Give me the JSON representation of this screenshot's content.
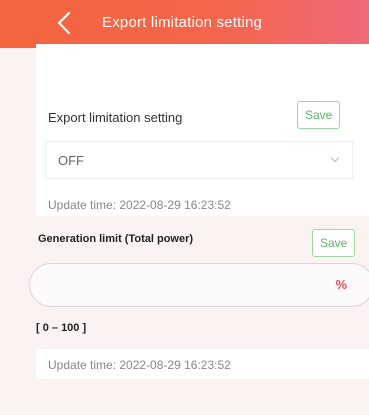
{
  "header": {
    "title": "Export limitation setting",
    "back_icon": "chevron-left-icon"
  },
  "export_limitation": {
    "label": "Export limitation setting",
    "save_label": "Save",
    "selected_value": "OFF",
    "dropdown_icon": "chevron-down-icon",
    "update_time": "Update time:  2022-08-29 16:23:52"
  },
  "generation_limit": {
    "label": "Generation limit (Total power)",
    "save_label": "Save",
    "value": "",
    "unit": "%",
    "range": "[ 0 – 100 ]",
    "update_time": "Update time:  2022-08-29 16:23:52"
  },
  "colors": {
    "header_gradient_start": "#f3653d",
    "header_gradient_end": "#f0697a",
    "save_button_text": "#5bb86a",
    "save_button_border": "#9fd7a5",
    "percent_unit": "#ef4c5b",
    "page_background": "#fbf3f1"
  }
}
